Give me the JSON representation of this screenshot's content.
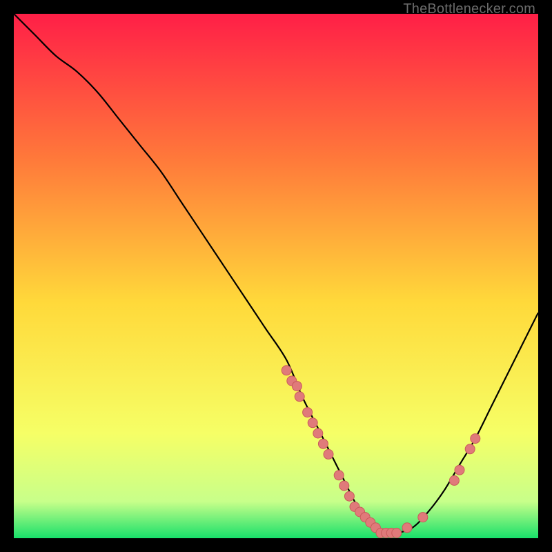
{
  "attribution": "TheBottlenecker.com",
  "colors": {
    "gradient_top": "#ff1f47",
    "gradient_mid_upper": "#ff7a3a",
    "gradient_mid": "#ffd93a",
    "gradient_mid_lower": "#f6ff66",
    "gradient_lower": "#c8ff8a",
    "gradient_bottom": "#18e06a",
    "curve": "#000000",
    "marker_fill": "#e07a7a",
    "marker_stroke": "#c95b5b",
    "frame": "#000000"
  },
  "chart_data": {
    "type": "line",
    "title": "",
    "xlabel": "",
    "ylabel": "",
    "xlim": [
      0,
      100
    ],
    "ylim": [
      0,
      100
    ],
    "series": [
      {
        "name": "bottleneck-curve",
        "x": [
          0,
          4,
          8,
          12,
          16,
          20,
          24,
          28,
          32,
          36,
          40,
          44,
          48,
          52,
          55,
          58,
          61,
          63,
          65,
          67,
          69,
          71,
          73,
          76,
          79,
          82,
          85,
          88,
          91,
          94,
          97,
          100
        ],
        "y": [
          100,
          96,
          92,
          89,
          85,
          80,
          75,
          70,
          64,
          58,
          52,
          46,
          40,
          34,
          27,
          21,
          15,
          11,
          7,
          4,
          2,
          1,
          1,
          2,
          5,
          9,
          14,
          19,
          25,
          31,
          37,
          43
        ]
      }
    ],
    "markers": {
      "name": "highlighted-points",
      "x": [
        52,
        53,
        54,
        54.5,
        56,
        57,
        58,
        59,
        60,
        62,
        63,
        64,
        65,
        66,
        67,
        68,
        69,
        70,
        71,
        72,
        73,
        75,
        78,
        84,
        85,
        87,
        88
      ],
      "y": [
        32,
        30,
        29,
        27,
        24,
        22,
        20,
        18,
        16,
        12,
        10,
        8,
        6,
        5,
        4,
        3,
        2,
        1,
        1,
        1,
        1,
        2,
        4,
        11,
        13,
        17,
        19
      ]
    }
  }
}
